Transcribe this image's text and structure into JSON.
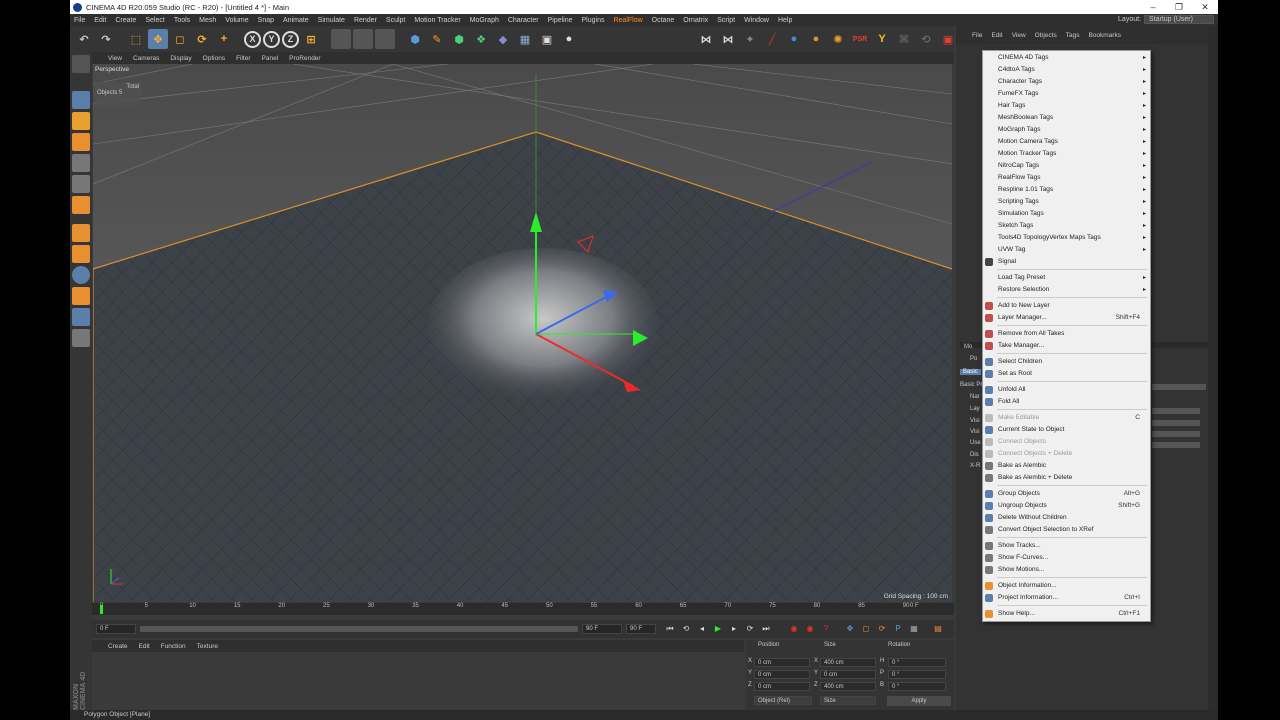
{
  "window": {
    "title": "CINEMA 4D R20.059 Studio (RC - R20) - [Untitled 4 *] - Main",
    "min": "–",
    "max": "❐",
    "close": "✕"
  },
  "menubar": [
    "File",
    "Edit",
    "Create",
    "Select",
    "Tools",
    "Mesh",
    "Volume",
    "Snap",
    "Animate",
    "Simulate",
    "Render",
    "Sculpt",
    "Motion Tracker",
    "MoGraph",
    "Character",
    "Pipeline",
    "Plugins",
    "RealFlow",
    "Octane",
    "Ornatrix",
    "Script",
    "Window",
    "Help"
  ],
  "layout": {
    "label": "Layout:",
    "value": "Startup (User)"
  },
  "toolbar": {
    "undo": "↶",
    "redo": "↷",
    "select": "⬚",
    "move": "✥",
    "scale": "◻",
    "rotate": "⟳",
    "add": "+",
    "x": "X",
    "y": "Y",
    "z": "Z",
    "coord": "⊞"
  },
  "viewport": {
    "menu": [
      "View",
      "Cameras",
      "Display",
      "Options",
      "Filter",
      "Panel",
      "ProRender"
    ],
    "label": "Perspective",
    "stats_total": "Total",
    "stats_objects_label": "Objects",
    "stats_objects_value": "5",
    "grid_spacing": "Grid Spacing : 100 cm"
  },
  "timeline": {
    "ticks": [
      "0",
      "5",
      "10",
      "15",
      "20",
      "25",
      "30",
      "35",
      "40",
      "45",
      "50",
      "55",
      "60",
      "65",
      "70",
      "75",
      "80",
      "85",
      "90"
    ],
    "frame_end": "0 F",
    "start": "0 F",
    "end_field": "90 F",
    "end_field2": "90 F"
  },
  "material_manager": {
    "menu": [
      "Create",
      "Edit",
      "Function",
      "Texture"
    ],
    "brand": "MAXON CINEMA 4D"
  },
  "coords": {
    "headers": [
      "Position",
      "Size",
      "Rotation"
    ],
    "rows": [
      {
        "axis": "X",
        "pos": "0 cm",
        "size_axis": "X",
        "size": "400 cm",
        "rot_axis": "H",
        "rot": "0 °"
      },
      {
        "axis": "Y",
        "pos": "0 cm",
        "size_axis": "Y",
        "size": "0 cm",
        "rot_axis": "P",
        "rot": "0 °"
      },
      {
        "axis": "Z",
        "pos": "0 cm",
        "size_axis": "Z",
        "size": "400 cm",
        "rot_axis": "B",
        "rot": "0 °"
      }
    ],
    "mode": "Object (Rel)",
    "size_mode": "Size",
    "apply": "Apply"
  },
  "status": "Polygon Object [Plane]",
  "right_panel": {
    "menu": [
      "File",
      "Edit",
      "View",
      "Objects",
      "Tags",
      "Bookmarks"
    ],
    "attr_tab": "Basic",
    "attr_labels": [
      "Mo",
      "Po",
      "Basic Pr",
      "Nar",
      "Lay",
      "Visi",
      "Visi",
      "Use",
      "Dis",
      "X-R"
    ]
  },
  "context_menu": {
    "items": [
      {
        "label": "CINEMA 4D Tags",
        "arrow": "▸"
      },
      {
        "label": "C4dtoA Tags",
        "arrow": "▸"
      },
      {
        "label": "Character Tags",
        "arrow": "▸"
      },
      {
        "label": "FumeFX Tags",
        "arrow": "▸"
      },
      {
        "label": "Hair Tags",
        "arrow": "▸"
      },
      {
        "label": "MeshBoolean Tags",
        "arrow": "▸"
      },
      {
        "label": "MoGraph Tags",
        "arrow": "▸"
      },
      {
        "label": "Motion Camera Tags",
        "arrow": "▸"
      },
      {
        "label": "Motion Tracker Tags",
        "arrow": "▸"
      },
      {
        "label": "NitroCap Tags",
        "arrow": "▸"
      },
      {
        "label": "RealFlow Tags",
        "arrow": "▸"
      },
      {
        "label": "Respline 1.01 Tags",
        "arrow": "▸"
      },
      {
        "label": "Scripting Tags",
        "arrow": "▸"
      },
      {
        "label": "Simulation Tags",
        "arrow": "▸"
      },
      {
        "label": "Sketch Tags",
        "arrow": "▸"
      },
      {
        "label": "Tools4D TopologyVertex Maps Tags",
        "arrow": "▸"
      },
      {
        "label": "UVW Tag",
        "arrow": "▸"
      },
      {
        "label": "Signal"
      },
      {
        "label": "Load Tag Preset",
        "arrow": "▸"
      },
      {
        "label": "Restore Selection",
        "arrow": "▸"
      },
      {
        "label": "Add to New Layer"
      },
      {
        "label": "Layer Manager...",
        "shortcut": "Shift+F4"
      },
      {
        "label": "Remove from All Takes"
      },
      {
        "label": "Take Manager..."
      },
      {
        "label": "Select Children"
      },
      {
        "label": "Set as Root"
      },
      {
        "label": "Unfold All"
      },
      {
        "label": "Fold All"
      },
      {
        "label": "Make Editable",
        "shortcut": "C",
        "disabled": true
      },
      {
        "label": "Current State to Object"
      },
      {
        "label": "Connect Objects",
        "disabled": true
      },
      {
        "label": "Connect Objects + Delete",
        "disabled": true
      },
      {
        "label": "Bake as Alembic"
      },
      {
        "label": "Bake as Alembic + Delete"
      },
      {
        "label": "Group Objects",
        "shortcut": "Alt+G"
      },
      {
        "label": "Ungroup Objects",
        "shortcut": "Shift+G"
      },
      {
        "label": "Delete Without Children"
      },
      {
        "label": "Convert Object Selection to XRef"
      },
      {
        "label": "Show Tracks..."
      },
      {
        "label": "Show F-Curves..."
      },
      {
        "label": "Show Motions..."
      },
      {
        "label": "Object Information..."
      },
      {
        "label": "Project Information...",
        "shortcut": "Ctrl+I"
      },
      {
        "label": "Show Help...",
        "shortcut": "Ctrl+F1"
      }
    ]
  }
}
